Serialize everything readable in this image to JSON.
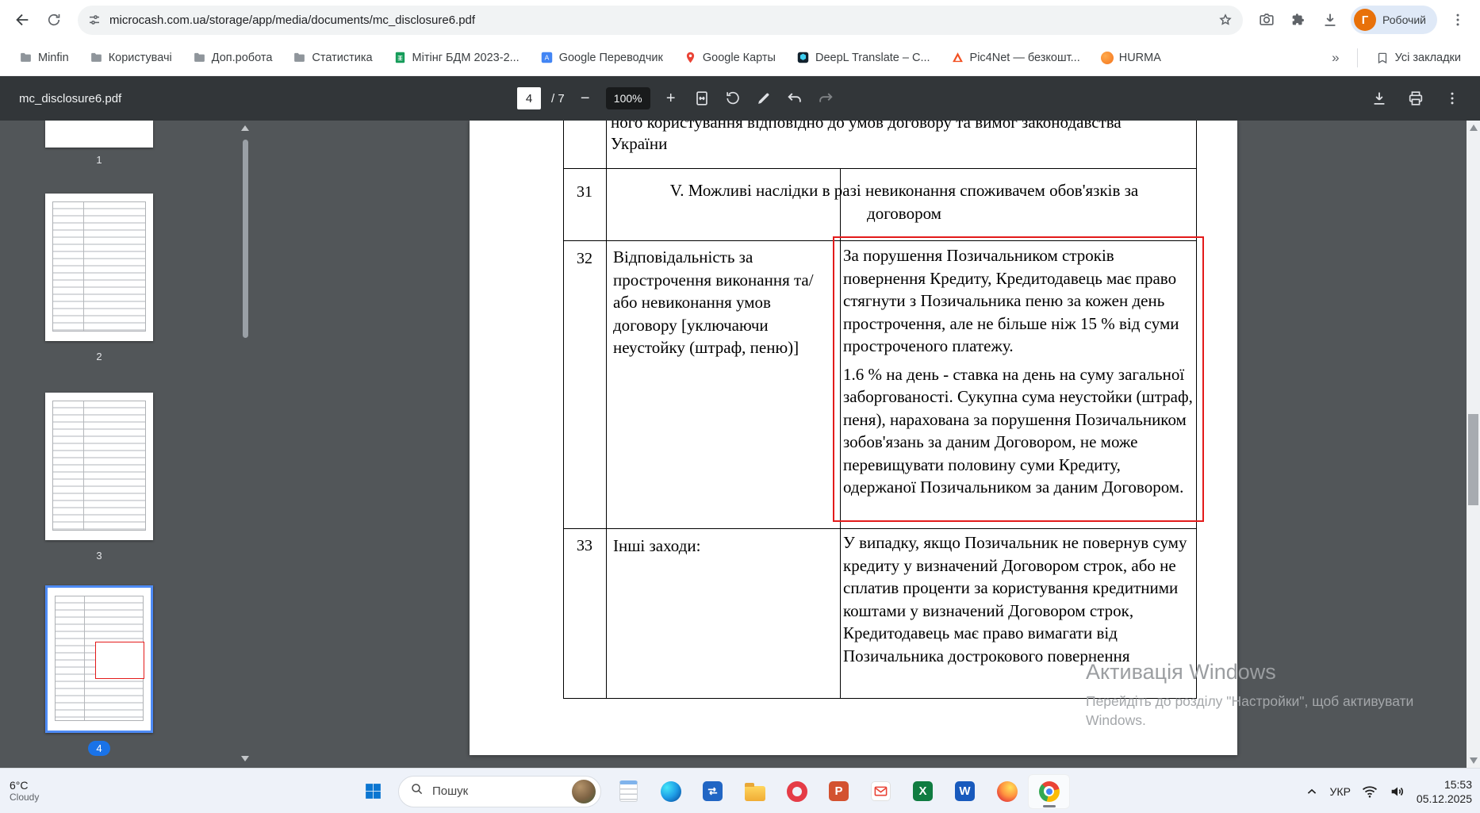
{
  "browser": {
    "url": "microcash.com.ua/storage/app/media/documents/mc_disclosure6.pdf",
    "profile": {
      "name": "Робочий",
      "initial": "Г"
    },
    "bookmarks": [
      "Minfin",
      "Користувачі",
      "Доп.робота",
      "Статистика",
      "Мітінг БДМ 2023-2...",
      "Google Переводчик",
      "Google Карты",
      "DeepL Translate – С...",
      "Pic4Net — безкошт...",
      "HURMA"
    ],
    "overflow_chevron": "»",
    "all_bookmarks_label": "Усі закладки",
    "icons": [
      "back-icon",
      "refresh-icon",
      "site-settings-icon",
      "bookmark-star-icon",
      "screenshot-camera-icon",
      "extensions-puzzle-icon",
      "downloads-icon",
      "browser-menu-icon"
    ]
  },
  "pdf_toolbar": {
    "filename": "mc_disclosure6.pdf",
    "page_current": "4",
    "page_total": "/ 7",
    "zoom_out": "−",
    "zoom_level": "100%",
    "zoom_in": "+",
    "icons": [
      "fit-page-icon",
      "rotate-icon",
      "annotate-pen-icon",
      "undo-icon",
      "redo-icon",
      "download-icon",
      "print-icon",
      "more-menu-icon"
    ]
  },
  "sidebar": {
    "thumbnails": [
      {
        "label": "1",
        "selected": false
      },
      {
        "label": "2",
        "selected": false
      },
      {
        "label": "3",
        "selected": false
      },
      {
        "label": "4",
        "selected": true
      }
    ]
  },
  "document": {
    "highlight_color": "#e31b1b",
    "top_clipped_line": "ного користування відповідно до умов договору та вимог законодавства",
    "top_line2": "України",
    "rows": [
      {
        "num": "31",
        "title": "V. Можливі наслідки в разі невиконання споживачем обов'язків за договором"
      },
      {
        "num": "32",
        "label": "Відповідальність за прострочення виконання та/або невиконання умов договору [уключаючи неустойку (штраф, пеню)]",
        "value_p1": "За порушення Позичальником строків повернення Кредиту, Кредитодавець має право стягнути з Позичальника пеню за кожен день прострочення, але не більше ніж 15 % від суми простроченого платежу.",
        "value_p2": "1.6 % на день - ставка на день на суму загальної заборгованості. Сукупна сума неустойки (штраф, пеня), нарахована за порушення Позичальником зобов'язань за даним Договором, не може перевищувати половину суми Кредиту, одержаної Позичальником за даним Договором."
      },
      {
        "num": "33",
        "label": "Інші заходи:",
        "value": "У випадку, якщо Позичальник не повернув суму кредиту у визначений Договором строк, або не сплатив проценти за користування кредитними коштами у визначений Договором строк, Кредитодавець має право вимагати від Позичальника дострокового повернення"
      }
    ]
  },
  "watermark": {
    "line1": "Активація Windows",
    "line2": "Перейдіть до розділу \"Настройки\", щоб активувати",
    "line3": "Windows."
  },
  "taskbar": {
    "weather_temp": "6°C",
    "weather_condition": "Cloudy",
    "search_placeholder": "Пошук",
    "apps": [
      "notepad",
      "edge",
      "remote-tool",
      "file-explorer",
      "opera",
      "powerpoint",
      "mail",
      "excel",
      "word",
      "firefox",
      "chrome"
    ],
    "app_letters": {
      "powerpoint": "P",
      "excel": "X",
      "word": "W"
    },
    "tray": {
      "language": "УКР",
      "time": "15:53",
      "date": "05.12.2025"
    }
  }
}
